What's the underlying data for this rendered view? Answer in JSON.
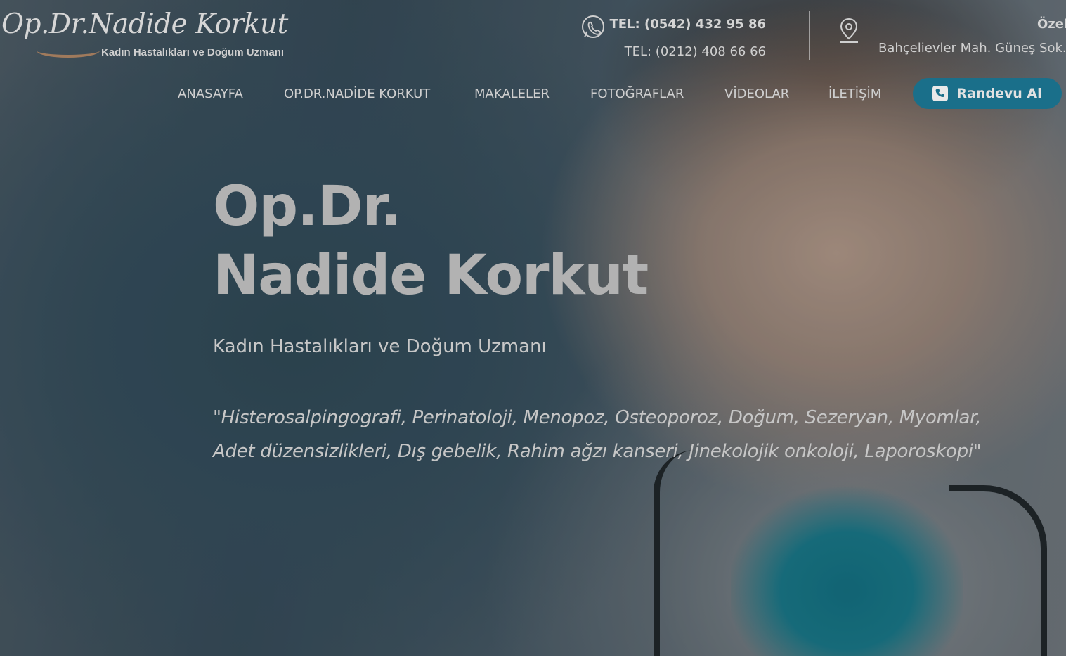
{
  "header": {
    "logo_name": "Op.Dr.Nadide Korkut",
    "logo_subtitle": "Kadın Hastalıkları ve Doğum Uzmanı",
    "phone_1": "TEL:  (0542) 432 95 86",
    "phone_2": "TEL: (0212) 408 66 66",
    "address_title": "Özel",
    "address_line": "Bahçelievler Mah. Güneş Sok."
  },
  "nav": {
    "items": [
      "ANASAYFA",
      "OP.DR.NADİDE KORKUT",
      "MAKALELER",
      "FOTOĞRAFLAR",
      "VİDEOLAR",
      "İLETİŞİM"
    ],
    "cta_label": "Randevu Al"
  },
  "hero": {
    "title_line_1": "Op.Dr.",
    "title_line_2": "Nadide Korkut",
    "subtitle": "Kadın Hastalıkları ve Doğum Uzmanı",
    "quote_line_1": "\"Histerosalpingografi, Perinatoloji, Menopoz, Osteoporoz, Doğum, Sezeryan, Myomlar,",
    "quote_line_2": "Adet düzensizlikleri, Dış gebelik, Rahim ağzı kanseri, Jinekolojik onkoloji, Laporoskopi\""
  },
  "colors": {
    "accent": "#1a6f8a",
    "text_light": "#cfcfcf",
    "logo_swoosh": "#a07a5c"
  },
  "icons": [
    "whatsapp-icon",
    "location-pin-icon",
    "phone-icon"
  ]
}
